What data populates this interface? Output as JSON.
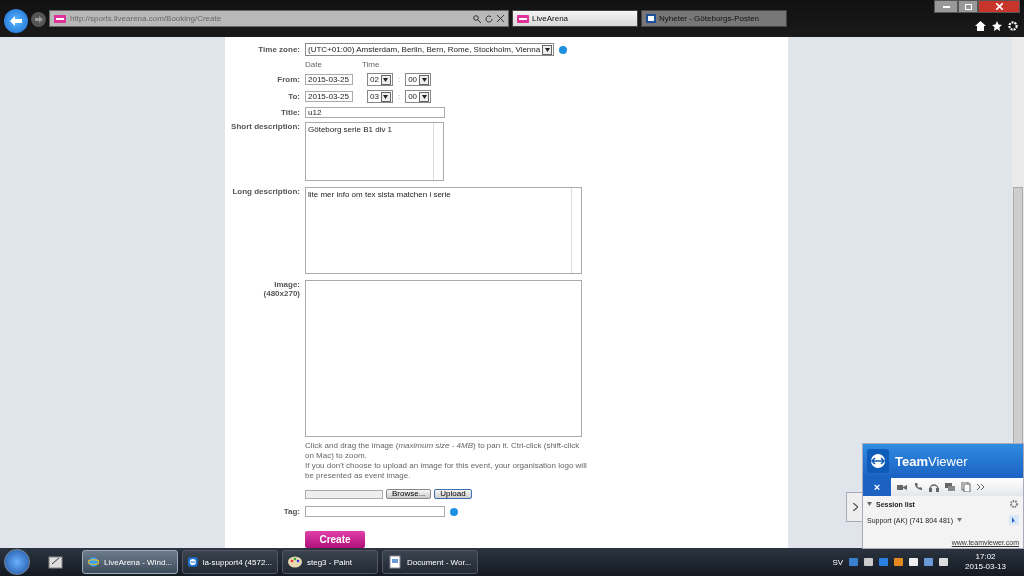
{
  "browser": {
    "address": "http://sports.livearena.com/Booking/Create",
    "tabs": [
      {
        "label": "LiveArena",
        "selected": true
      },
      {
        "label": "Nyheter - Göteborgs-Posten",
        "selected": false
      }
    ]
  },
  "form": {
    "time_zone": {
      "label": "Time zone:",
      "value": "(UTC+01:00) Amsterdam, Berlin, Bern, Rome, Stockholm, Vienna"
    },
    "headers": {
      "date": "Date",
      "time": "Time"
    },
    "from": {
      "label": "From:",
      "date": "2015-03-25",
      "hour": "02",
      "minute": "00",
      "separator": ":"
    },
    "to": {
      "label": "To:",
      "date": "2015-03-25",
      "hour": "03",
      "minute": "00",
      "separator": ":"
    },
    "title": {
      "label": "Title:",
      "value": "u12"
    },
    "short_description": {
      "label": "Short description:",
      "value": "Göteborg serie B1 div 1"
    },
    "long_description": {
      "label": "Long description:",
      "value": "lite mer info om tex sista matchen i serie"
    },
    "image": {
      "label": "Image:",
      "size": "(480x270)"
    },
    "help": [
      "Click and drag the image (*maximum size - 4MB*) to pan it. Ctrl-click (shift-click on Mac) to zoom.",
      "If you don't choose to upload an image for this event, your organisation logo will be presented as event image."
    ],
    "browse": "Browse...",
    "upload": "Upload",
    "tag": {
      "label": "Tag:"
    },
    "create": "Create"
  },
  "teamviewer": {
    "brand_a": "Team",
    "brand_b": "Viewer",
    "close": "×",
    "session_list": "Session list",
    "session": "Support (AK) (741 804 481)",
    "link": "www.teamviewer.com"
  },
  "taskbar": {
    "items": [
      {
        "label": "LiveArena - Wind...",
        "kind": "ie",
        "selected": true
      },
      {
        "label": "la-support4 (4572...",
        "kind": "teamviewer",
        "selected": false
      },
      {
        "label": "steg3 - Paint",
        "kind": "paint",
        "selected": false
      },
      {
        "label": "Document - Wor...",
        "kind": "doc",
        "selected": false
      }
    ],
    "language": "SV",
    "time": "17:02",
    "date": "2015-03-13"
  }
}
